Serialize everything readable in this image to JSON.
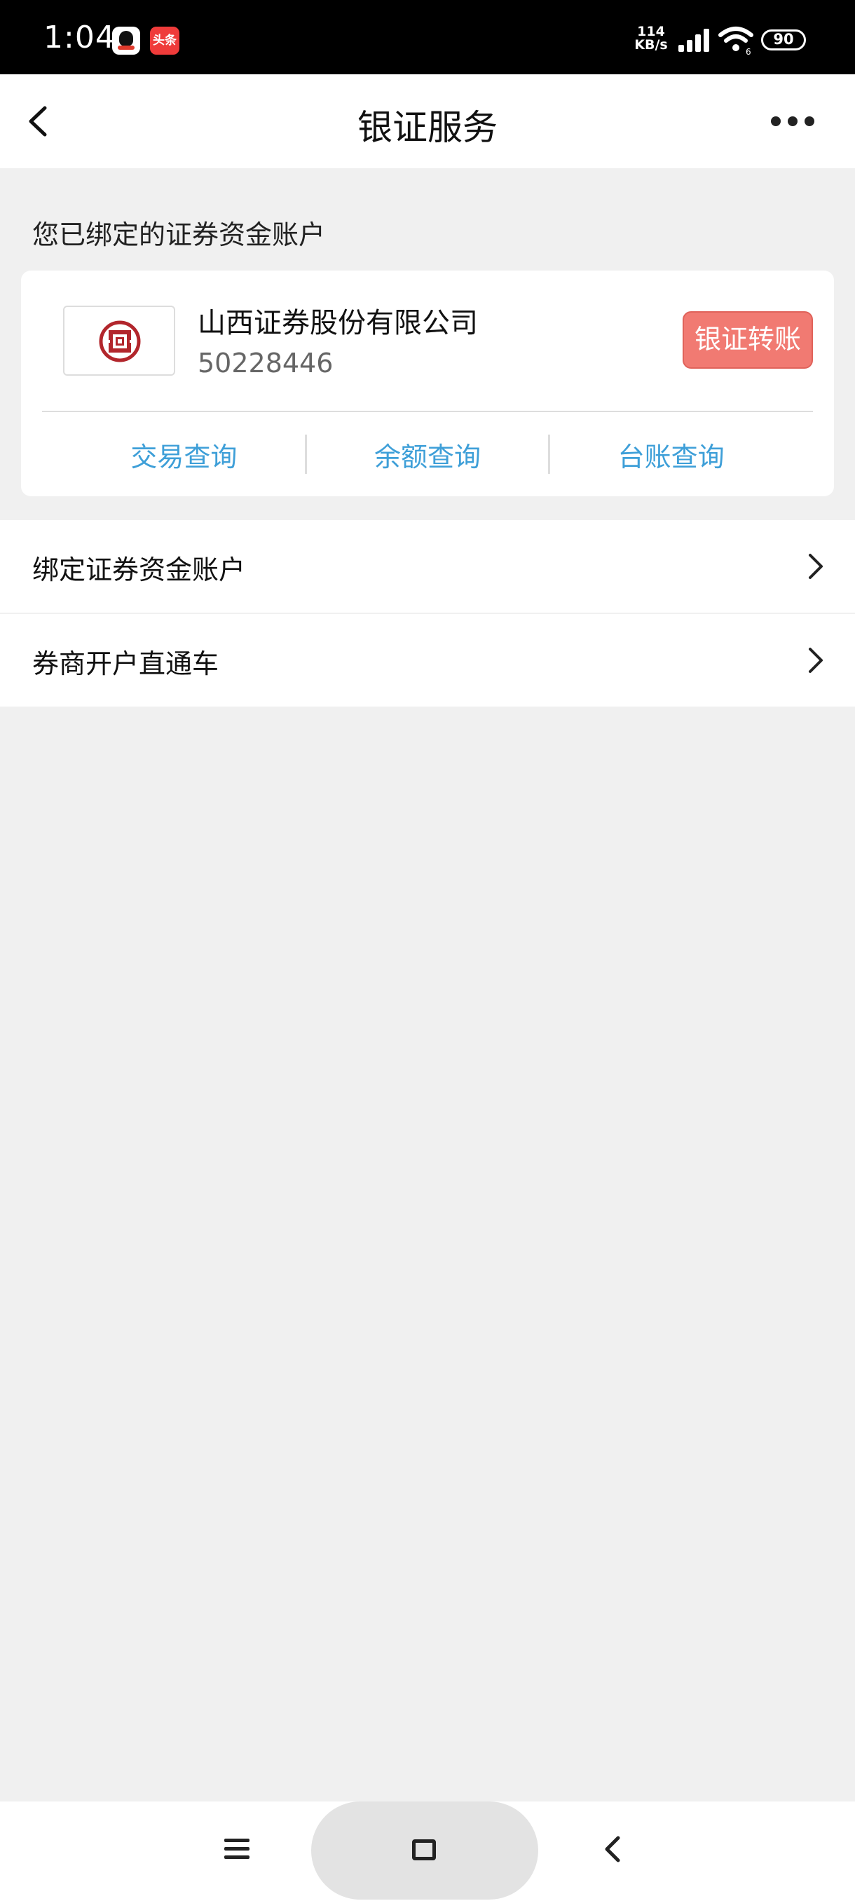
{
  "status_bar": {
    "time": "1:04",
    "toutiao_label": "头条",
    "net_speed_value": "114",
    "net_speed_unit": "KB/s",
    "battery": "90"
  },
  "header": {
    "title": "银证服务"
  },
  "bound_accounts": {
    "section_title": "您已绑定的证券资金账户",
    "account": {
      "broker_name": "山西证券股份有限公司",
      "account_number": "50228446",
      "transfer_label": "银证转账",
      "actions": [
        {
          "label": "交易查询"
        },
        {
          "label": "余额查询"
        },
        {
          "label": "台账查询"
        }
      ]
    }
  },
  "menu": {
    "items": [
      {
        "label": "绑定证券资金账户"
      },
      {
        "label": "券商开户直通车"
      }
    ]
  },
  "colors": {
    "accent_blue": "#3e9fd8",
    "transfer_button": "#f17a72",
    "logo_red": "#b2262c",
    "background": "#f0f0f0"
  }
}
